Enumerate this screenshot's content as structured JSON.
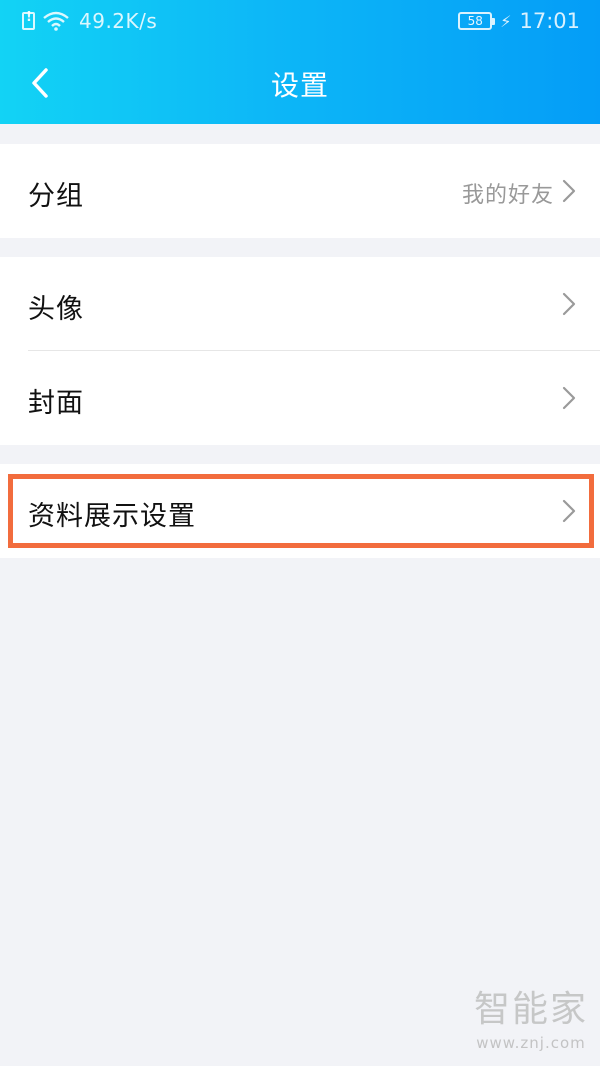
{
  "status_bar": {
    "network_speed": "49.2K/s",
    "battery_level": "58",
    "time": "17:01"
  },
  "nav": {
    "title": "设置"
  },
  "sections": {
    "group": {
      "label": "分组",
      "value": "我的好友"
    },
    "avatar": {
      "label": "头像"
    },
    "cover": {
      "label": "封面"
    },
    "profile_display": {
      "label": "资料展示设置"
    }
  },
  "watermark": {
    "brand": "智能家",
    "url": "www.znj.com"
  },
  "colors": {
    "header_gradient_start": "#12d3f5",
    "header_gradient_end": "#049df7",
    "background": "#f2f3f7",
    "highlight": "#f26c3d"
  }
}
